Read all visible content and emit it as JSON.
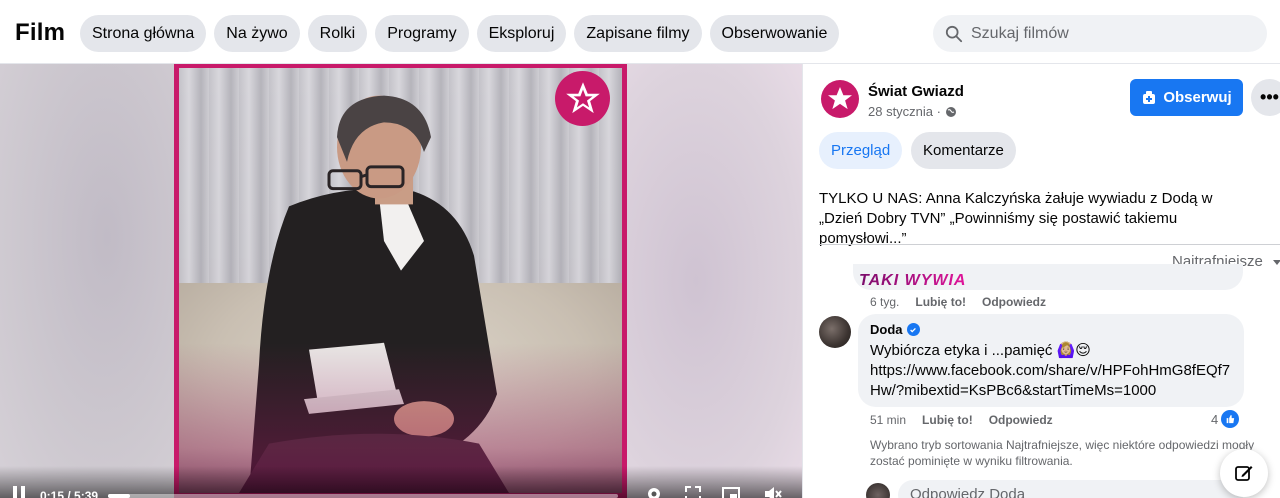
{
  "header": {
    "brand": "Film",
    "nav": [
      "Strona główna",
      "Na żywo",
      "Rolki",
      "Programy",
      "Eksploruj",
      "Zapisane filmy",
      "Obserwowanie"
    ],
    "search_placeholder": "Szukaj filmów"
  },
  "player": {
    "time": "0:15 / 5:39",
    "progress": 0.044,
    "icons": [
      "pause-icon",
      "settings-icon",
      "fullscreen-icon",
      "pip-icon",
      "volume-icon"
    ]
  },
  "post": {
    "page_name": "Świat Gwiazd",
    "date": "28 stycznia ·",
    "follow_label": "Obserwuj",
    "more_label": "•••",
    "tabs": [
      "Przegląd",
      "Komentarze"
    ],
    "text": "TYLKO U NAS: Anna Kalczyńska żałuje wywiadu z Dodą w „Dzień Dobry TVN” „Powinniśmy się postawić takiemu pomysłowi...”"
  },
  "comments": {
    "sort_label": "Najtrafniejsze",
    "previous": {
      "sticker_text": "TAKI WYWIA",
      "time": "6 tyg.",
      "like": "Lubię to!",
      "reply": "Odpowiedz"
    },
    "doda": {
      "author": "Doda",
      "text_line1": "Wybiórcza etyka i ...pamięć 🙆🏼‍♀️😌",
      "link": "https://www.facebook.com/share/v/HPFohHmG8fEQf7Hw/?mibextid=KsPBc6&startTimeMs=1000",
      "time": "51 min",
      "like": "Lubię to!",
      "reply": "Odpowiedz",
      "reaction_count": "4"
    },
    "notice": "Wybrano tryb sortowania Najtrafniejsze, więc niektóre odpowiedzi mogły zostać pominięte w wyniku filtrowania.",
    "reply_placeholder": "Odpowiedz Doda"
  },
  "colors": {
    "accent": "#1877f2",
    "brand_pink": "#c81a6a"
  }
}
